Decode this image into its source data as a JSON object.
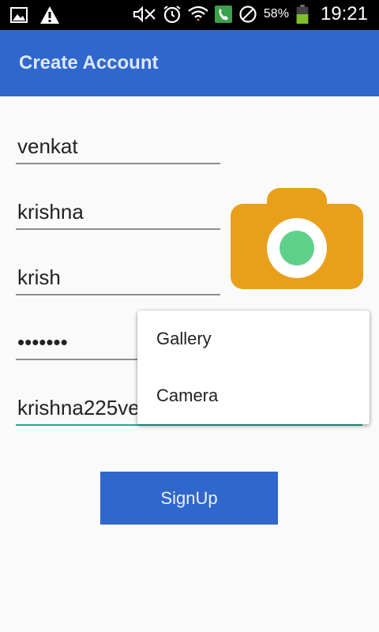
{
  "status_bar": {
    "battery_percent": "58%",
    "time": "19:21",
    "icons": [
      "image-icon",
      "warning-icon",
      "mute-icon",
      "alarm-icon",
      "wifi-icon",
      "phone-icon",
      "no-sim-icon",
      "battery-icon"
    ]
  },
  "app_bar": {
    "title": "Create Account"
  },
  "form": {
    "first_name": "venkat",
    "last_name": "krishna",
    "username": "krish",
    "password": "•••••••",
    "email": "krishna225venkat"
  },
  "popup_menu": {
    "items": [
      "Gallery",
      "Camera"
    ]
  },
  "buttons": {
    "signup_label": "SignUp"
  },
  "colors": {
    "primary": "#3067cc",
    "accent": "#26a69a",
    "camera_body": "#e8a01b",
    "camera_lens": "#5fd08a"
  }
}
